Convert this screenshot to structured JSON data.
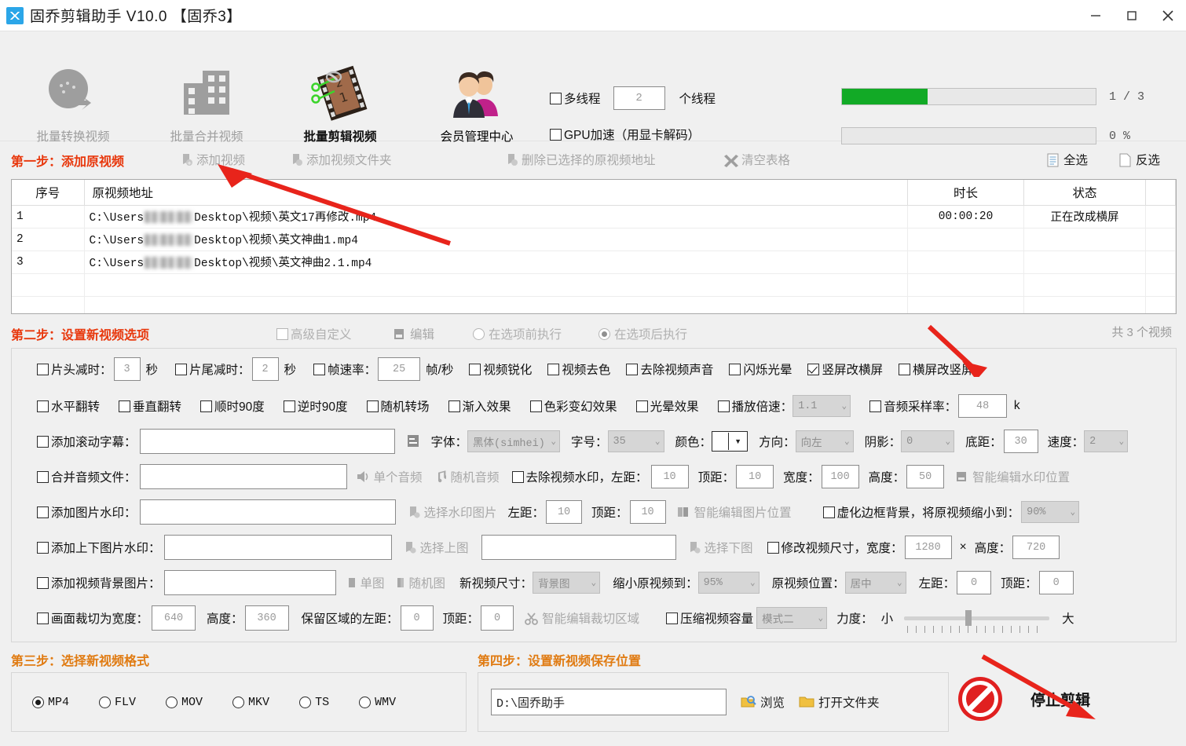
{
  "window": {
    "title": "固乔剪辑助手 V10.0  【固乔3】",
    "minimize": "−",
    "maximize": "▢",
    "close": "✕"
  },
  "toolbar": {
    "items": [
      {
        "label": "批量转换视频",
        "icon": "convert-video-icon",
        "state": "dim"
      },
      {
        "label": "批量合并视频",
        "icon": "merge-video-icon",
        "state": "dim"
      },
      {
        "label": "批量剪辑视频",
        "icon": "clip-video-icon",
        "state": "active"
      },
      {
        "label": "会员管理中心",
        "icon": "members-icon",
        "state": "normal"
      }
    ],
    "multithread_label": "多线程",
    "thread_count": "2",
    "thread_unit": "个线程",
    "gpu_label": "GPU加速（用显卡解码）",
    "progress_task": {
      "value": 34,
      "text": "1 / 3"
    },
    "progress_percent": {
      "value": 0,
      "text": "0 %"
    },
    "progress_color": "#12aa26"
  },
  "step1": {
    "title": "第一步：添加原视频",
    "add_video": "添加视频",
    "add_folder": "添加视频文件夹",
    "delete_selected": "删除已选择的原视频地址",
    "clear_table": "清空表格",
    "select_all": "全选",
    "invert_select": "反选"
  },
  "table": {
    "columns": [
      "序号",
      "原视频地址",
      "时长",
      "状态"
    ],
    "rows": [
      {
        "no": "1",
        "path_prefix": "C:\\Users",
        "path_suffix": "Desktop\\视频\\英文17再修改.mp4",
        "duration": "00:00:20",
        "status": "正在改成横屏"
      },
      {
        "no": "2",
        "path_prefix": "C:\\Users",
        "path_suffix": "Desktop\\视频\\英文神曲1.mp4",
        "duration": "",
        "status": ""
      },
      {
        "no": "3",
        "path_prefix": "C:\\Users",
        "path_suffix": "Desktop\\视频\\英文神曲2.1.mp4",
        "duration": "",
        "status": ""
      }
    ],
    "total_text": "共 3 个视频"
  },
  "step2": {
    "title": "第二步：设置新视频选项",
    "advanced_custom": "高级自定义",
    "edit": "编辑",
    "exec_before": "在选项前执行",
    "exec_after": "在选项后执行",
    "exec_selected": "after"
  },
  "options": {
    "row1": {
      "head_trim_label": "片头减时：",
      "head_trim_value": "3",
      "sec": "秒",
      "tail_trim_label": "片尾减时：",
      "tail_trim_value": "2",
      "sec2": "秒",
      "fps_label": "帧速率：",
      "fps_value": "25",
      "fps_unit": "帧/秒",
      "sharpen": "视频锐化",
      "decolor": "视频去色",
      "remove_audio": "去除视频声音",
      "flicker_halo": "闪烁光晕",
      "portrait_to_landscape": "竖屏改横屏",
      "landscape_to_portrait": "横屏改竖屏",
      "portrait_to_landscape_checked": true
    },
    "row2": {
      "hflip": "水平翻转",
      "vflip": "垂直翻转",
      "rot_cw": "顺时90度",
      "rot_ccw": "逆时90度",
      "random_transition": "随机转场",
      "fade_in": "渐入效果",
      "color_shift": "色彩变幻效果",
      "halo": "光晕效果",
      "speed_label": "播放倍速：",
      "speed_value": "1.1",
      "samplerate_label": "音频采样率：",
      "samplerate_value": "48",
      "samplerate_unit": "k"
    },
    "row3": {
      "scroll_sub": "添加滚动字幕：",
      "scroll_sub_value": "",
      "font_label": "字体：",
      "font_value": "黑体(simhei)",
      "size_label": "字号：",
      "size_value": "35",
      "color_label": "颜色：",
      "dir_label": "方向：",
      "dir_value": "向左",
      "shadow_label": "阴影：",
      "shadow_value": "0",
      "bottom_label": "底距：",
      "bottom_value": "30",
      "speed_label": "速度：",
      "speed_value": "2"
    },
    "row4": {
      "merge_audio": "合并音频文件：",
      "merge_audio_value": "",
      "single_audio": "单个音频",
      "random_audio": "随机音频",
      "remove_wm": "去除视频水印，左距：",
      "wm_left": "10",
      "wm_top_label": "顶距：",
      "wm_top": "10",
      "wm_w_label": "宽度：",
      "wm_w": "100",
      "wm_h_label": "高度：",
      "wm_h": "50",
      "smart_wm": "智能编辑水印位置"
    },
    "row5": {
      "add_img_wm": "添加图片水印：",
      "add_img_wm_value": "",
      "choose_wm_img": "选择水印图片",
      "left_label": "左距：",
      "left_value": "10",
      "top_label": "顶距：",
      "top_value": "10",
      "smart_img": "智能编辑图片位置",
      "blur_border": "虚化边框背景，将原视频缩小到：",
      "blur_border_value": "90%"
    },
    "row6": {
      "add_tb_wm": "添加上下图片水印：",
      "top_img_value": "",
      "bottom_img_value": "",
      "choose_top": "选择上图",
      "choose_bottom": "选择下图",
      "resize_label": "修改视频尺寸，宽度：",
      "resize_w": "1280",
      "x": "×",
      "resize_h_label": "高度：",
      "resize_h": "720"
    },
    "row7": {
      "add_bg_img": "添加视频背景图片：",
      "add_bg_img_value": "",
      "single_img": "单图",
      "random_img": "随机图",
      "new_size_label": "新视频尺寸：",
      "new_size_value": "背景图",
      "shrink_label": "缩小原视频到：",
      "shrink_value": "95%",
      "pos_label": "原视频位置：",
      "pos_value": "居中",
      "left_label": "左距：",
      "left_value": "0",
      "top_label": "顶距：",
      "top_value": "0"
    },
    "row8": {
      "crop_label": "画面裁切为宽度：",
      "crop_w": "640",
      "crop_h_label": "高度：",
      "crop_h": "360",
      "keep_left_label": "保留区域的左距：",
      "keep_left": "0",
      "keep_top_label": "顶距：",
      "keep_top": "0",
      "smart_crop": "智能编辑裁切区域",
      "compress": "压缩视频容量",
      "compress_mode": "模式二",
      "strength_label": "力度：",
      "strength_min": "小",
      "strength_max": "大"
    }
  },
  "step3": {
    "title": "第三步：选择新视频格式",
    "formats": [
      {
        "label": "MP4",
        "selected": true
      },
      {
        "label": "FLV",
        "selected": false
      },
      {
        "label": "MOV",
        "selected": false
      },
      {
        "label": "MKV",
        "selected": false
      },
      {
        "label": "TS",
        "selected": false
      },
      {
        "label": "WMV",
        "selected": false
      }
    ]
  },
  "step4": {
    "title": "第四步：设置新视频保存位置",
    "path": "D:\\固乔助手",
    "browse": "浏览",
    "open_folder": "打开文件夹"
  },
  "stop": {
    "label": "停止剪辑",
    "icon": "stop-prohibited-icon",
    "color": "#e02020"
  },
  "annotations": {
    "arrow_color": "#e8241b",
    "arrow_count": 3
  }
}
